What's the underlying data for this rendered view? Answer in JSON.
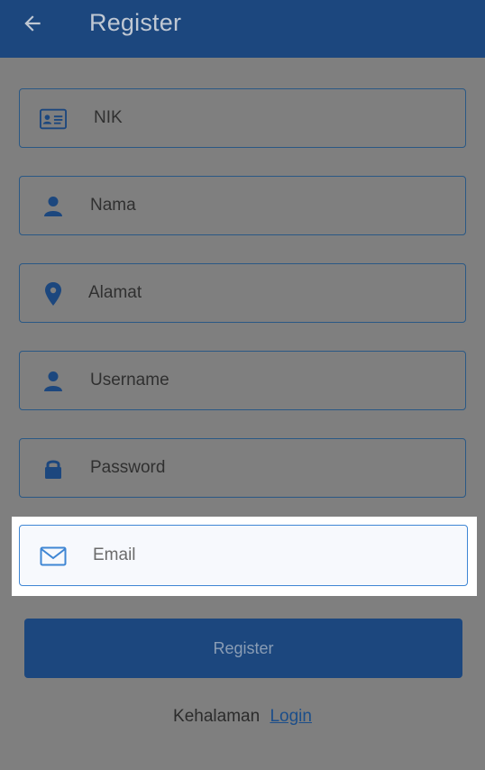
{
  "app_bar": {
    "title": "Register",
    "back_icon": "arrow-left-icon"
  },
  "form": {
    "fields": [
      {
        "key": "nik",
        "placeholder": "NIK",
        "icon": "id-card-icon"
      },
      {
        "key": "nama",
        "placeholder": "Nama",
        "icon": "user-icon"
      },
      {
        "key": "alamat",
        "placeholder": "Alamat",
        "icon": "map-pin-icon"
      },
      {
        "key": "username",
        "placeholder": "Username",
        "icon": "user-icon"
      },
      {
        "key": "password",
        "placeholder": "Password",
        "icon": "lock-icon"
      },
      {
        "key": "email",
        "placeholder": "Email",
        "icon": "envelope-icon",
        "focused": true
      }
    ],
    "submit_label": "Register"
  },
  "footer": {
    "prefix": "Kehalaman",
    "link_label": "Login"
  },
  "colors": {
    "primary": "#1c477e",
    "overlay_background": "#7f7f7f",
    "focus_border": "#3f86d4"
  }
}
